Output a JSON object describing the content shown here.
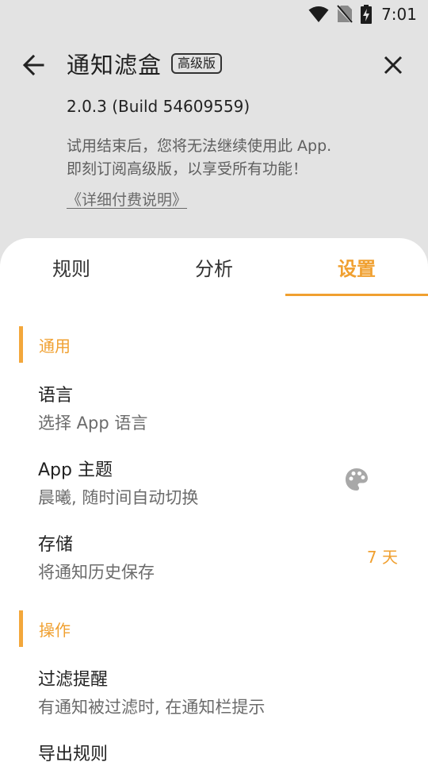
{
  "status_bar": {
    "time": "7:01"
  },
  "header": {
    "title": "通知滤盒",
    "badge": "高级版",
    "version": "2.0.3  (Build 54609559)",
    "trial_lines": [
      "试用结束后，您将无法继续使用此 App.",
      "即刻订阅高级版，以享受所有功能！"
    ],
    "pricing_link": "《详细付费说明》"
  },
  "tabs": [
    {
      "label": "规则",
      "active": false
    },
    {
      "label": "分析",
      "active": false
    },
    {
      "label": "设置",
      "active": true
    }
  ],
  "sections": {
    "general": {
      "label": "通用",
      "items": [
        {
          "title": "语言",
          "summary": "选择 App 语言"
        },
        {
          "title": "App 主题",
          "summary": "晨曦, 随时间自动切换",
          "icon": "palette-icon"
        },
        {
          "title": "存储",
          "summary": "将通知历史保存",
          "value": "7 天"
        }
      ]
    },
    "actions": {
      "label": "操作",
      "items": [
        {
          "title": "过滤提醒",
          "summary": "有通知被过滤时, 在通知栏提示"
        },
        {
          "title": "导出规则",
          "summary": ""
        }
      ]
    }
  },
  "colors": {
    "accent": "#f0a030",
    "background": "#e3e3e3",
    "panel": "#ffffff"
  }
}
